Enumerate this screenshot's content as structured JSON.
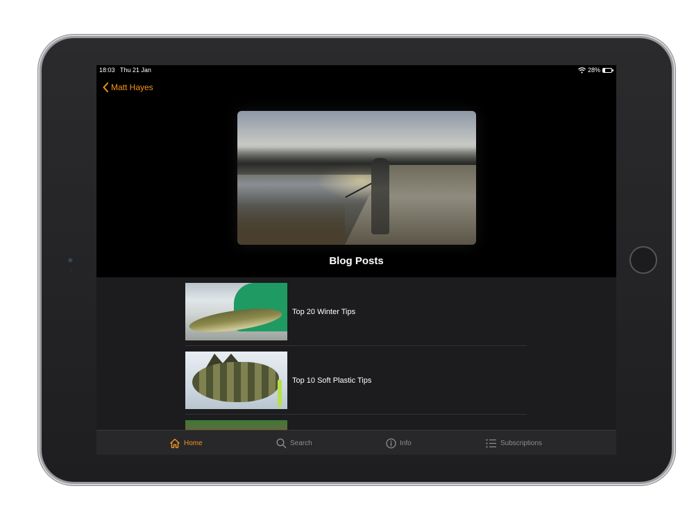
{
  "status_bar": {
    "time": "18:03",
    "date": "Thu 21 Jan",
    "battery": "28%",
    "battery_level": 0.28,
    "icons": [
      "wifi-icon",
      "battery-icon"
    ]
  },
  "nav": {
    "back_label": "Matt Hayes",
    "back_icon": "chevron-left-icon"
  },
  "section_title": "Blog Posts",
  "posts": [
    {
      "title": "Top 20 Winter Tips"
    },
    {
      "title": "Top 10 Soft Plastic Tips"
    },
    {
      "title": ""
    }
  ],
  "tabs": [
    {
      "label": "Home",
      "icon": "home-icon",
      "active": true
    },
    {
      "label": "Search",
      "icon": "search-icon",
      "active": false
    },
    {
      "label": "Info",
      "icon": "info-icon",
      "active": false
    },
    {
      "label": "Subscriptions",
      "icon": "list-icon",
      "active": false
    }
  ],
  "colors": {
    "accent": "#f7941d",
    "background": "#000000",
    "list_background": "#1c1c1e",
    "tab_inactive": "#8e8e93"
  }
}
